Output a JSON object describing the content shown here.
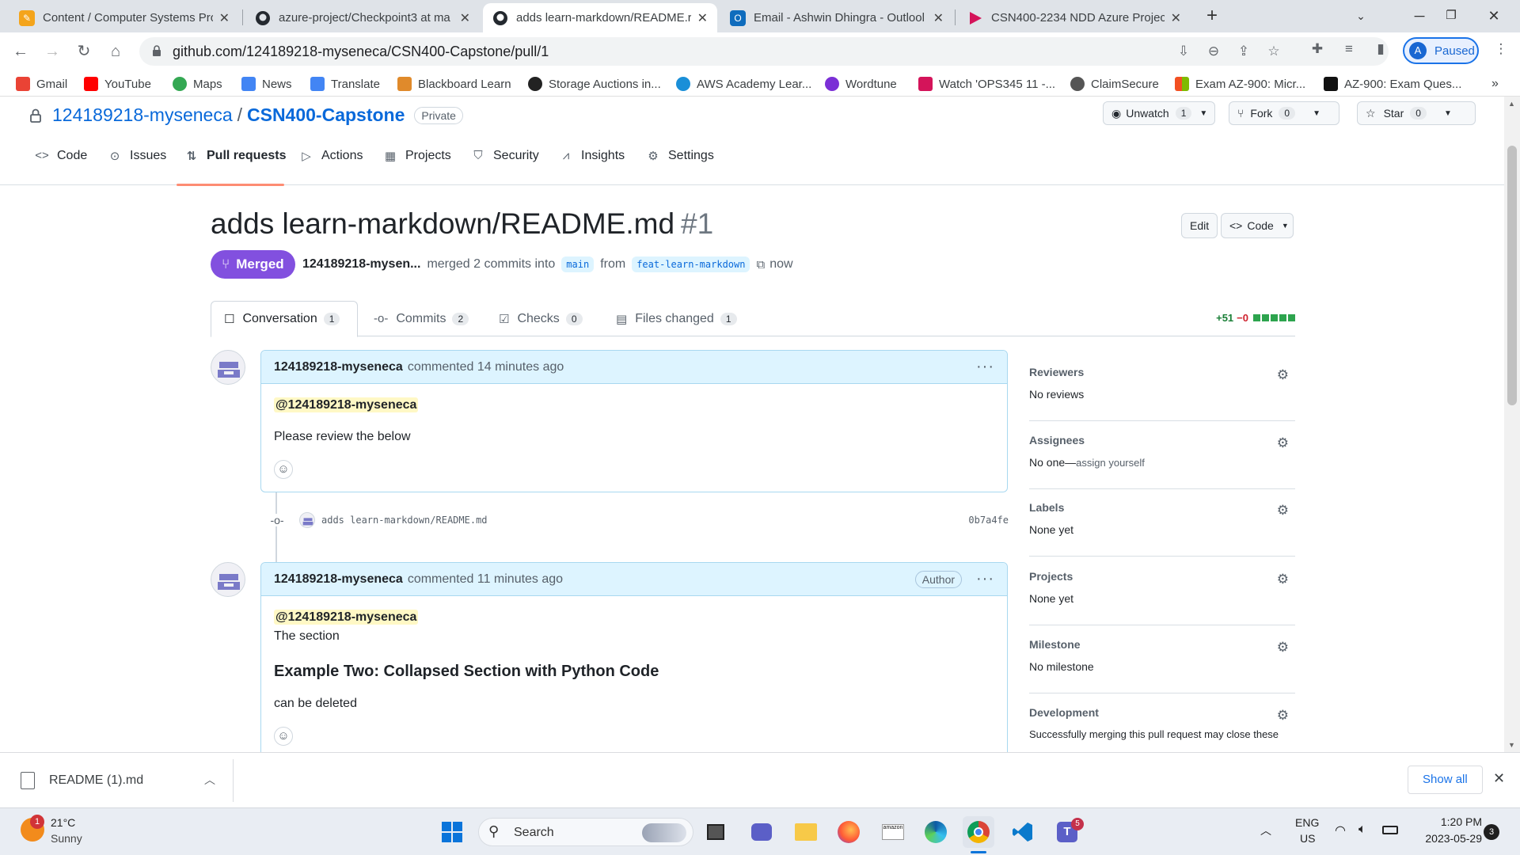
{
  "browser": {
    "tabs": [
      {
        "title": "Content / Computer Systems Pro",
        "icon": "doc-icon",
        "color": "#f4a41b"
      },
      {
        "title": "azure-project/Checkpoint3 at ma",
        "icon": "github-icon",
        "color": "#24292f"
      },
      {
        "title": "adds learn-markdown/README.r",
        "icon": "github-icon",
        "color": "#24292f",
        "active": true
      },
      {
        "title": "Email - Ashwin Dhingra - Outlool",
        "icon": "outlook-icon",
        "color": "#0f6cbd"
      },
      {
        "title": "CSN400-2234 NDD Azure Project",
        "icon": "play-icon",
        "color": "#d4145a"
      }
    ],
    "url": "github.com/124189218-myseneca/CSN400-Capstone/pull/1",
    "profile_label": "Paused",
    "profile_initial": "A"
  },
  "bookmarks": [
    {
      "label": "Gmail",
      "color": "#ea4335"
    },
    {
      "label": "YouTube",
      "color": "#ff0000"
    },
    {
      "label": "Maps",
      "color": "#34a853"
    },
    {
      "label": "News",
      "color": "#4285f4"
    },
    {
      "label": "Translate",
      "color": "#4285f4"
    },
    {
      "label": "Blackboard Learn",
      "color": "#e08a2b"
    },
    {
      "label": "Storage Auctions in...",
      "color": "#222222"
    },
    {
      "label": "AWS Academy Lear...",
      "color": "#1a8fd8"
    },
    {
      "label": "Wordtune",
      "color": "#7b2fd6"
    },
    {
      "label": "Watch 'OPS345 11 -...",
      "color": "#d4145a"
    },
    {
      "label": "ClaimSecure",
      "color": "#555555"
    },
    {
      "label": "Exam AZ-900: Micr...",
      "color": "#f25022"
    },
    {
      "label": "AZ-900: Exam Ques...",
      "color": "#111111"
    }
  ],
  "repo": {
    "owner": "124189218-myseneca",
    "separator": "/",
    "name": "CSN400-Capstone",
    "visibility": "Private",
    "unwatch_label": "Unwatch",
    "unwatch_count": "1",
    "fork_label": "Fork",
    "fork_count": "0",
    "star_label": "Star",
    "star_count": "0"
  },
  "repo_nav": [
    {
      "label": "Code",
      "icon": "code-icon"
    },
    {
      "label": "Issues",
      "icon": "issue-icon"
    },
    {
      "label": "Pull requests",
      "icon": "pull-request-icon",
      "selected": true
    },
    {
      "label": "Actions",
      "icon": "play-circle-icon"
    },
    {
      "label": "Projects",
      "icon": "table-icon"
    },
    {
      "label": "Security",
      "icon": "shield-icon"
    },
    {
      "label": "Insights",
      "icon": "graph-icon"
    },
    {
      "label": "Settings",
      "icon": "gear-icon"
    }
  ],
  "pr": {
    "title": "adds learn-markdown/README.md",
    "number": "#1",
    "edit_label": "Edit",
    "code_label": "Code",
    "status": "Merged",
    "author": "124189218-mysen...",
    "merged_text": "merged 2 commits into",
    "base_branch": "main",
    "from_text": "from",
    "head_branch": "feat-learn-markdown",
    "time": "now"
  },
  "pr_tabs": [
    {
      "label": "Conversation",
      "count": "1",
      "icon": "comment-icon"
    },
    {
      "label": "Commits",
      "count": "2",
      "icon": "commit-icon"
    },
    {
      "label": "Checks",
      "count": "0",
      "icon": "checklist-icon"
    },
    {
      "label": "Files changed",
      "count": "1",
      "icon": "file-diff-icon"
    }
  ],
  "diffstat": {
    "additions": "+51",
    "deletions": "−0"
  },
  "comments": [
    {
      "author": "124189218-myseneca",
      "action": "commented 14 minutes ago",
      "mention": "@124189218-myseneca",
      "body": "Please review the below"
    },
    {
      "author": "124189218-myseneca",
      "action": "commented 11 minutes ago",
      "badge": "Author",
      "mention": "@124189218-myseneca",
      "line1": "The section",
      "heading": "Example Two: Collapsed Section with Python Code",
      "line2": "can be deleted"
    }
  ],
  "commit": {
    "message": "adds learn-markdown/README.md",
    "sha": "0b7a4fe"
  },
  "sidebar": [
    {
      "title": "Reviewers",
      "value": "No reviews"
    },
    {
      "title": "Assignees",
      "value": "No one—",
      "link": "assign yourself"
    },
    {
      "title": "Labels",
      "value": "None yet"
    },
    {
      "title": "Projects",
      "value": "None yet"
    },
    {
      "title": "Milestone",
      "value": "No milestone"
    },
    {
      "title": "Development",
      "value": "Successfully merging this pull request may close these"
    }
  ],
  "download": {
    "filename": "README (1).md",
    "show_all": "Show all"
  },
  "taskbar": {
    "weather_temp": "21°C",
    "weather_cond": "Sunny",
    "weather_badge": "1",
    "search_placeholder": "Search",
    "lang": "ENG",
    "region": "US",
    "time": "1:20 PM",
    "date": "2023-05-29",
    "notif_count": "3",
    "teams_badge": "5"
  }
}
